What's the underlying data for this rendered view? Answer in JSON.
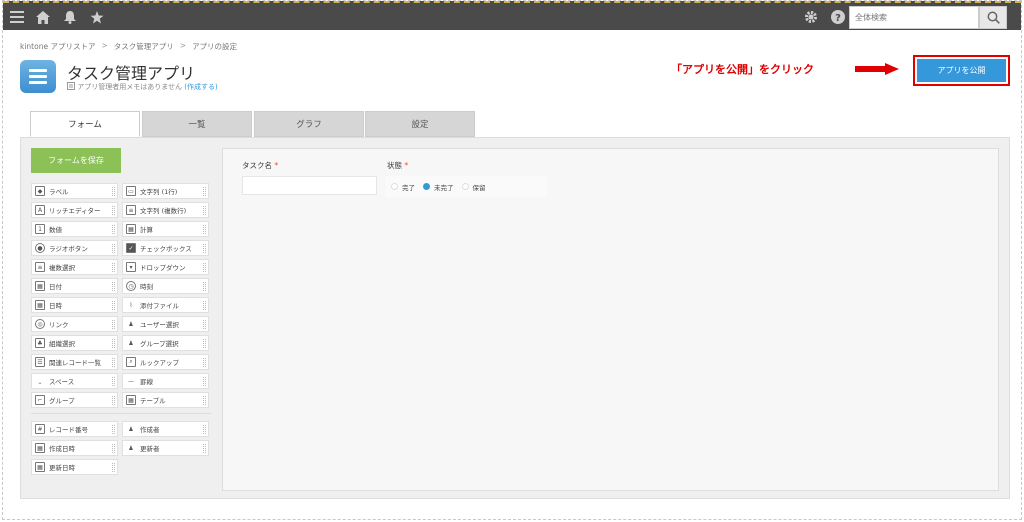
{
  "search": {
    "placeholder": "全体検索"
  },
  "breadcrumb": [
    "kintone アプリストア",
    "タスク管理アプリ",
    "アプリの設定"
  ],
  "breadcrumb_sep": ">",
  "app": {
    "title": "タスク管理アプリ",
    "memo": "アプリ管理者用メモはありません",
    "memo_link": "(作成する)"
  },
  "annotation": "「アプリを公開」をクリック",
  "publish_label": "アプリを公開",
  "tabs": [
    "フォーム",
    "一覧",
    "グラフ",
    "設定"
  ],
  "save_label": "フォームを保存",
  "palette_left": [
    "ラベル",
    "リッチエディター",
    "数値",
    "ラジオボタン",
    "複数選択",
    "日付",
    "日時",
    "リンク",
    "組織選択",
    "関連レコード一覧",
    "スペース",
    "グループ"
  ],
  "palette_right": [
    "文字列 (1行)",
    "文字列 (複数行)",
    "計算",
    "チェックボックス",
    "ドロップダウン",
    "時刻",
    "添付ファイル",
    "ユーザー選択",
    "グループ選択",
    "ルックアップ",
    "罫線",
    "テーブル"
  ],
  "system_left": [
    "レコード番号",
    "作成日時",
    "更新日時"
  ],
  "system_right": [
    "作成者",
    "更新者"
  ],
  "form": {
    "task_label": "タスク名",
    "status_label": "状態",
    "required_mark": "*",
    "status_options": [
      "完了",
      "未完了",
      "保留"
    ],
    "status_selected": "未完了"
  },
  "colors": {
    "accent": "#3498db",
    "save": "#8cc157",
    "annotation": "#e00000",
    "topbar": "#4a4a4a"
  }
}
